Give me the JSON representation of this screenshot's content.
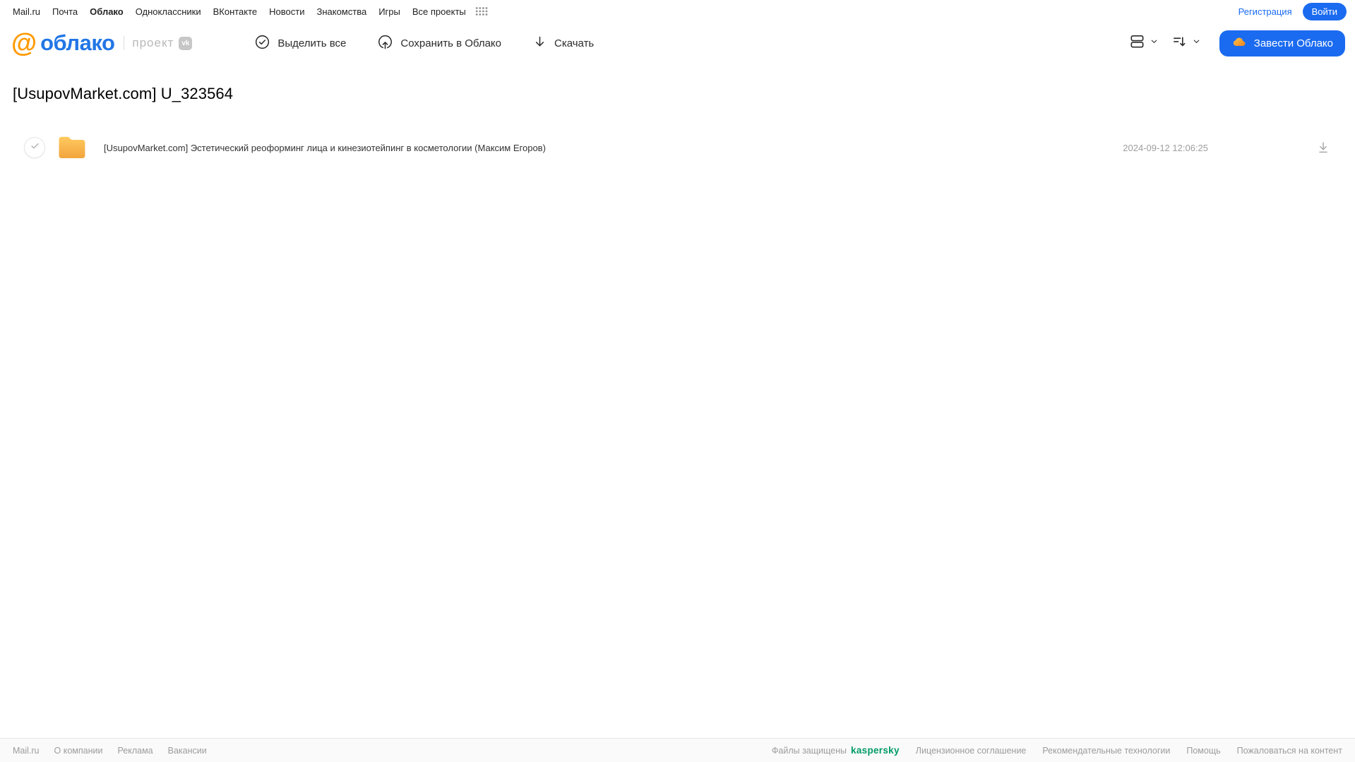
{
  "topnav": {
    "links": [
      "Mail.ru",
      "Почта",
      "Облако",
      "Одноклассники",
      "ВКонтакте",
      "Новости",
      "Знакомства",
      "Игры",
      "Все проекты"
    ],
    "active_link": "Облако",
    "registration": "Регистрация",
    "login": "Войти"
  },
  "header": {
    "logo_at": "@",
    "logo_text": "облако",
    "project_label": "проект",
    "vk_badge": "vk",
    "toolbar": [
      {
        "label": "Выделить все",
        "icon": "check-circle-icon"
      },
      {
        "label": "Сохранить в Облако",
        "icon": "cloud-upload-icon"
      },
      {
        "label": "Скачать",
        "icon": "download-icon"
      }
    ],
    "view_control_icon": "list-view-icon",
    "sort_control_icon": "sort-icon",
    "create_cloud_button": "Завести Облако"
  },
  "main": {
    "title": "[UsupovMarket.com] U_323564",
    "files": [
      {
        "type": "folder",
        "name": "[UsupovMarket.com] Эстетический реоформинг лица и кинезиотейпинг в косметологии (Максим Егоров)",
        "date": "2024-09-12 12:06:25"
      }
    ]
  },
  "footer": {
    "left_links": [
      "Mail.ru",
      "О компании",
      "Реклама",
      "Вакансии"
    ],
    "protected_text": "Файлы защищены",
    "kaspersky_label": "kaspersky",
    "right_links": [
      "Лицензионное соглашение",
      "Рекомендательные технологии",
      "Помощь",
      "Пожаловаться на контент"
    ]
  },
  "colors": {
    "accent_blue": "#1b6bf0",
    "logo_blue": "#2276e6",
    "logo_orange": "#ff9a00",
    "folder_orange_top": "#ffca60",
    "folder_orange_bottom": "#f2a43c",
    "kaspersky_green": "#009a68",
    "muted_gray": "#9c9c9c"
  }
}
